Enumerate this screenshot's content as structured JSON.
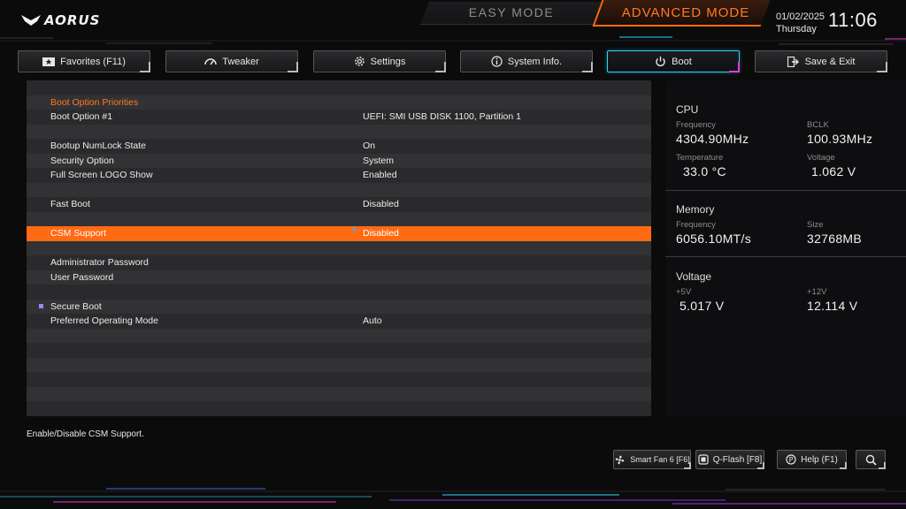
{
  "header": {
    "logo_text": "AORUS",
    "easy_mode_label": "EASY MODE",
    "advanced_mode_label": "ADVANCED MODE",
    "date": "01/02/2025",
    "weekday": "Thursday",
    "time": "11:06"
  },
  "tabs": [
    {
      "label": "Favorites (F11)",
      "icon": "star-folder-icon"
    },
    {
      "label": "Tweaker",
      "icon": "speedometer-icon"
    },
    {
      "label": "Settings",
      "icon": "gear-icon"
    },
    {
      "label": "System Info.",
      "icon": "info-icon"
    },
    {
      "label": "Boot",
      "icon": "power-icon",
      "active": true
    },
    {
      "label": "Save & Exit",
      "icon": "exit-icon"
    }
  ],
  "boot": {
    "rows": [
      {
        "label": "",
        "value": ""
      },
      {
        "label": "Boot Option Priorities",
        "value": ""
      },
      {
        "label": "Boot Option #1",
        "value": "UEFI: SMI USB DISK 1100, Partition 1"
      },
      {
        "label": "",
        "value": ""
      },
      {
        "label": "Bootup NumLock State",
        "value": "On"
      },
      {
        "label": "Security Option",
        "value": "System"
      },
      {
        "label": "Full Screen LOGO Show",
        "value": "Enabled"
      },
      {
        "label": "",
        "value": ""
      },
      {
        "label": "Fast Boot",
        "value": "Disabled"
      },
      {
        "label": "",
        "value": ""
      },
      {
        "label": "CSM Support",
        "value": "Disabled"
      },
      {
        "label": "",
        "value": ""
      },
      {
        "label": "Administrator Password",
        "value": ""
      },
      {
        "label": "User Password",
        "value": ""
      },
      {
        "label": "",
        "value": ""
      },
      {
        "label": "Secure Boot",
        "value": ""
      },
      {
        "label": "Preferred Operating Mode",
        "value": "Auto"
      },
      {
        "label": "",
        "value": ""
      },
      {
        "label": "",
        "value": ""
      },
      {
        "label": "",
        "value": ""
      },
      {
        "label": "",
        "value": ""
      },
      {
        "label": "",
        "value": ""
      },
      {
        "label": "",
        "value": ""
      }
    ]
  },
  "side": {
    "cpu": {
      "title": "CPU",
      "frequency_label": "Frequency",
      "frequency": "4304.90MHz",
      "bclk_label": "BCLK",
      "bclk": "100.93MHz",
      "temperature_label": "Temperature",
      "temperature": "33.0 °C",
      "voltage_label": "Voltage",
      "voltage": "1.062 V"
    },
    "memory": {
      "title": "Memory",
      "frequency_label": "Frequency",
      "frequency": "6056.10MT/s",
      "size_label": "Size",
      "size": "32768MB"
    },
    "voltage": {
      "title": "Voltage",
      "v5_label": "+5V",
      "v5": "5.017 V",
      "v12_label": "+12V",
      "v12": "12.114 V"
    }
  },
  "footer": {
    "help_text": "Enable/Disable CSM Support.",
    "smart_fan_label": "Smart Fan 6 [F6]",
    "qflash_label": "Q-Flash [F8]",
    "help_label": "Help (F1)"
  },
  "colors": {
    "accent": "#ff6a13",
    "active_tab": "#2ad6f5"
  }
}
